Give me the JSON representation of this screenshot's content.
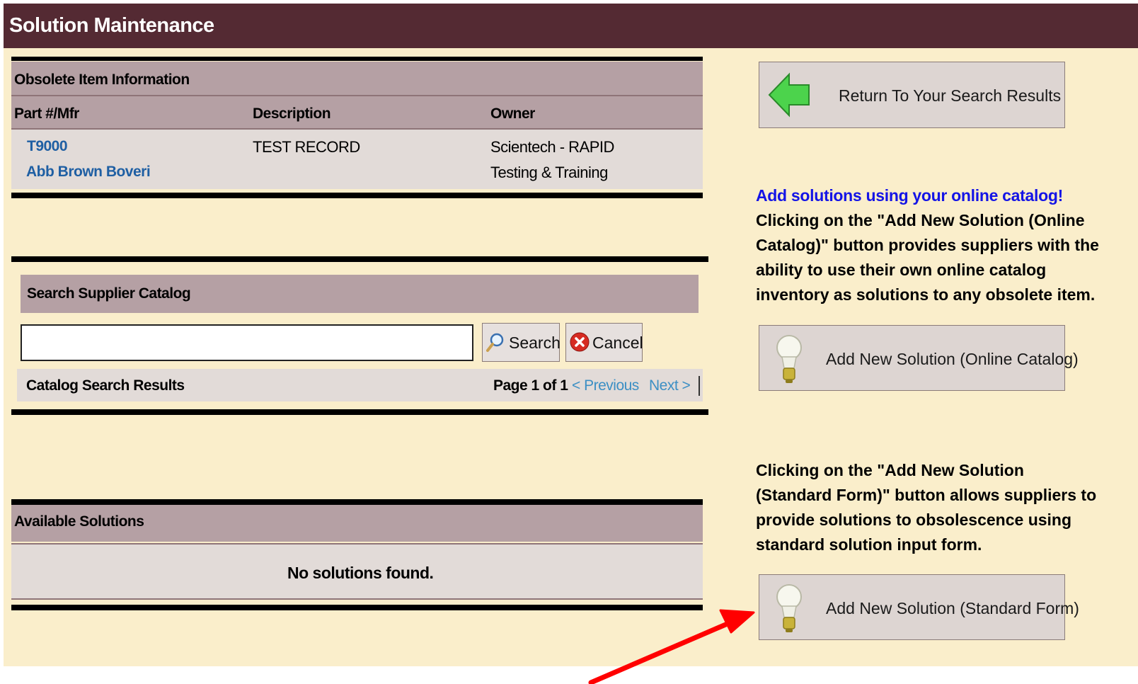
{
  "title": "Solution Maintenance",
  "obsolete": {
    "section_title": "Obsolete Item Information",
    "columns": [
      "Part #/Mfr",
      "Description",
      "Owner"
    ],
    "part_number": "T9000",
    "manufacturer": "Abb Brown Boveri",
    "description": "TEST RECORD",
    "owner_line1": "Scientech - RAPID",
    "owner_line2": "Testing & Training"
  },
  "catalog": {
    "section_title": "Search Supplier Catalog",
    "search_value": "",
    "search_label": "Search",
    "cancel_label": "Cancel",
    "results_title": "Catalog Search Results",
    "page_info": "Page 1 of 1",
    "prev_label": "< Previous",
    "next_label": "Next >"
  },
  "solutions": {
    "section_title": "Available Solutions",
    "empty_message": "No solutions found."
  },
  "sidebar": {
    "return_label": "Return To Your Search Results",
    "online_heading": "Add solutions using your online catalog!",
    "online_desc": [
      "Clicking on the \"Add New Solution (Online",
      "Catalog)\" button provides suppliers with the",
      "ability to use their own online catalog",
      "inventory as solutions to any obsolete item."
    ],
    "online_button_label": "Add New Solution (Online Catalog)",
    "standard_desc": [
      "Clicking on the \"Add New Solution",
      "(Standard Form)\" button allows suppliers to",
      "provide solutions to obsolescence using",
      "standard solution input form."
    ],
    "standard_button_label": "Add New Solution (Standard Form)"
  },
  "colors": {
    "title_bar": "#542a33",
    "background": "#faeecb",
    "section_band": "#b5a0a4",
    "link": "#1f5fa3",
    "annotation_arrow": "#ff0000"
  }
}
